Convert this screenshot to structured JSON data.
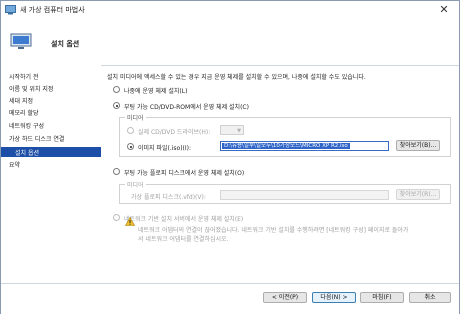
{
  "window": {
    "title": "새 가상 컴퓨터 마법사",
    "close_glyph": "✕"
  },
  "header": {
    "title": "설치 옵션"
  },
  "sidebar": {
    "items": [
      {
        "label": "시작하기 전",
        "active": false
      },
      {
        "label": "이름 및 위치 지정",
        "active": false
      },
      {
        "label": "세대 지정",
        "active": false
      },
      {
        "label": "메모리 할당",
        "active": false
      },
      {
        "label": "네트워킹 구성",
        "active": false
      },
      {
        "label": "가상 하드 디스크 연결",
        "active": false
      },
      {
        "label": "설치 옵션",
        "active": true
      },
      {
        "label": "요약",
        "active": false
      }
    ]
  },
  "main": {
    "intro": "설치 미디어에 액세스할 수 있는 경우 지금 운영 체제를 설치할 수 있으며, 나중에 설치할 수도 있습니다.",
    "opt_later": "나중에 운영 체제 설치(L)",
    "opt_cd": "부팅 가능 CD/DVD-ROM에서 운영 체제 설치(C)",
    "cd_media_label": "미디어",
    "cd_physical_label": "실제 CD/DVD 드라이브(H):",
    "cd_image_label": "이미지 파일(.iso)(I):",
    "cd_image_value": "D:\\유용\\일부\\일모두\\10가상모드\\MICRO XP R2.iso",
    "cd_browse": "찾아보기(B)...",
    "opt_floppy": "부팅 가능 플로피 디스크에서 운영 체제 설치(O)",
    "floppy_media_label": "미디어",
    "floppy_disk_label": "가상 플로피 디스크(.vfd)(V):",
    "floppy_value": "",
    "floppy_browse": "찾아보기(R)...",
    "opt_network": "네트워크 기반 설치 서버에서 운영 체제 설치(E)",
    "network_warning_line1": "네트워크 어댑터의 연결이 끊어졌습니다. 네트워크 기반 설치를 수행하려면 [네트워킹 구성] 페이지로 돌아가",
    "network_warning_line2": "서 네트워크 어댑터를 연결하십시오."
  },
  "footer": {
    "prev": "< 이전(P)",
    "next": "다음(N) >",
    "finish": "마침(F)",
    "cancel": "취소"
  },
  "colors": {
    "accent": "#1e4fa8",
    "selection": "#2f64c8"
  },
  "icons": {
    "app": "hyperv-wizard-icon",
    "header": "monitor-icon",
    "warning": "warning-icon"
  }
}
